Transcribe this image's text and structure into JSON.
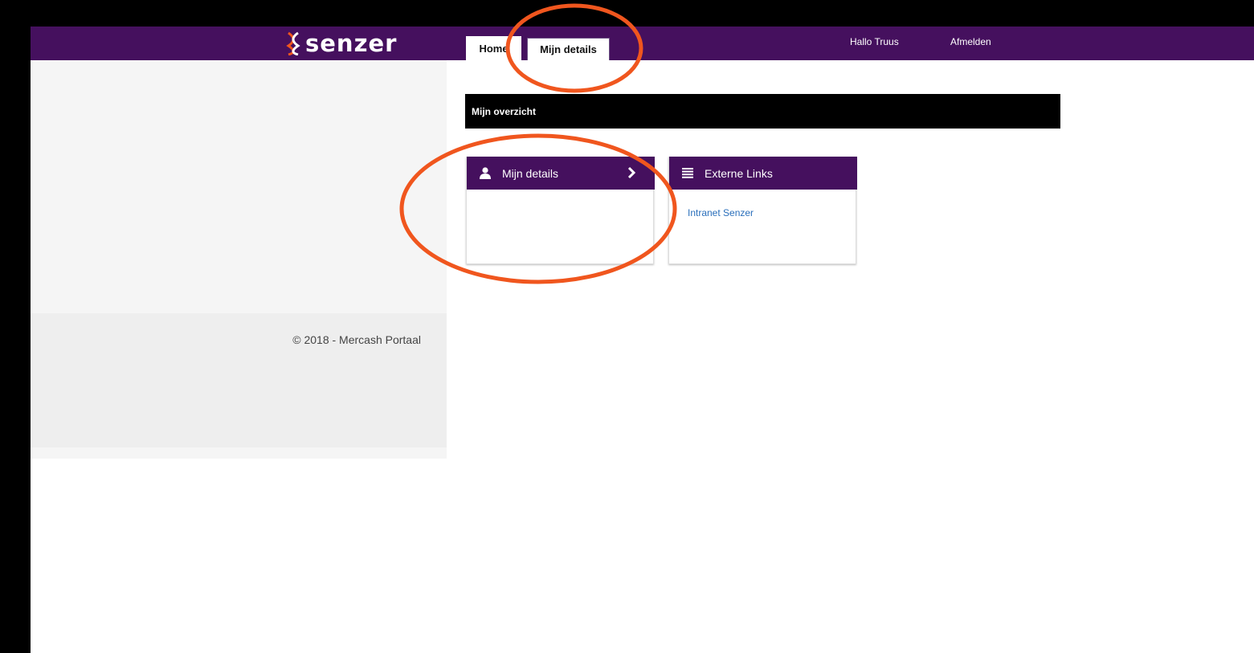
{
  "brand": {
    "logo_text": "senzer",
    "colors": {
      "header": "#45105e",
      "accent_circle": "#f0561e",
      "link": "#2a6fbb"
    }
  },
  "nav": {
    "tabs": [
      {
        "label": "Home",
        "active": true
      },
      {
        "label": "Mijn details",
        "active": false
      }
    ],
    "greeting": "Hallo Truus",
    "logout_label": "Afmelden"
  },
  "main": {
    "section_title": "Mijn overzicht",
    "tiles": [
      {
        "title": "Mijn details",
        "icon": "user-icon",
        "has_chevron": true,
        "links": []
      },
      {
        "title": "Externe Links",
        "icon": "list-icon",
        "links": [
          {
            "label": "Intranet Senzer"
          }
        ]
      }
    ]
  },
  "footer": {
    "copyright": "© 2018 - Mercash Portaal"
  }
}
